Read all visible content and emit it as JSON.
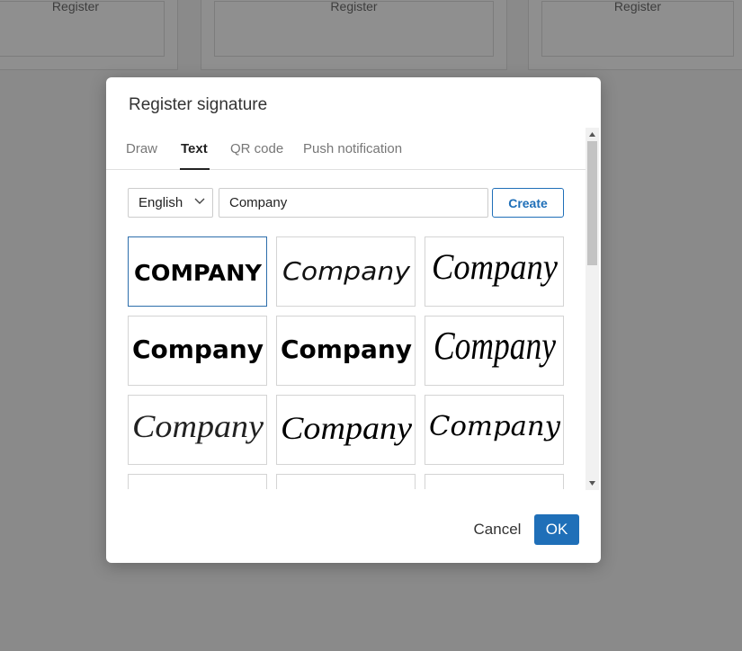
{
  "background": {
    "cards": [
      {
        "label": "Register"
      },
      {
        "label": "Register"
      },
      {
        "label": "Register"
      }
    ]
  },
  "dialog": {
    "title": "Register signature",
    "tabs": [
      {
        "label": "Draw",
        "active": false
      },
      {
        "label": "Text",
        "active": true
      },
      {
        "label": "QR code",
        "active": false
      },
      {
        "label": "Push notification",
        "active": false
      }
    ],
    "language": {
      "selected": "English",
      "icon": "chevron-down-icon"
    },
    "name_input": {
      "value": "Company"
    },
    "create_label": "Create",
    "signature_text": "Company",
    "signatures": [
      {
        "style": "bold-caps",
        "selected": true
      },
      {
        "style": "thin-script",
        "selected": false
      },
      {
        "style": "brush-italic",
        "selected": false
      },
      {
        "style": "marker",
        "selected": false
      },
      {
        "style": "rounded-bold",
        "selected": false
      },
      {
        "style": "tall-script",
        "selected": false
      },
      {
        "style": "calligraphy",
        "selected": false
      },
      {
        "style": "formal-script",
        "selected": false
      },
      {
        "style": "cursive",
        "selected": false
      }
    ],
    "cancel_label": "Cancel",
    "ok_label": "OK"
  },
  "colors": {
    "accent": "#1f6fb8",
    "overlay": "#8a8a8a"
  }
}
